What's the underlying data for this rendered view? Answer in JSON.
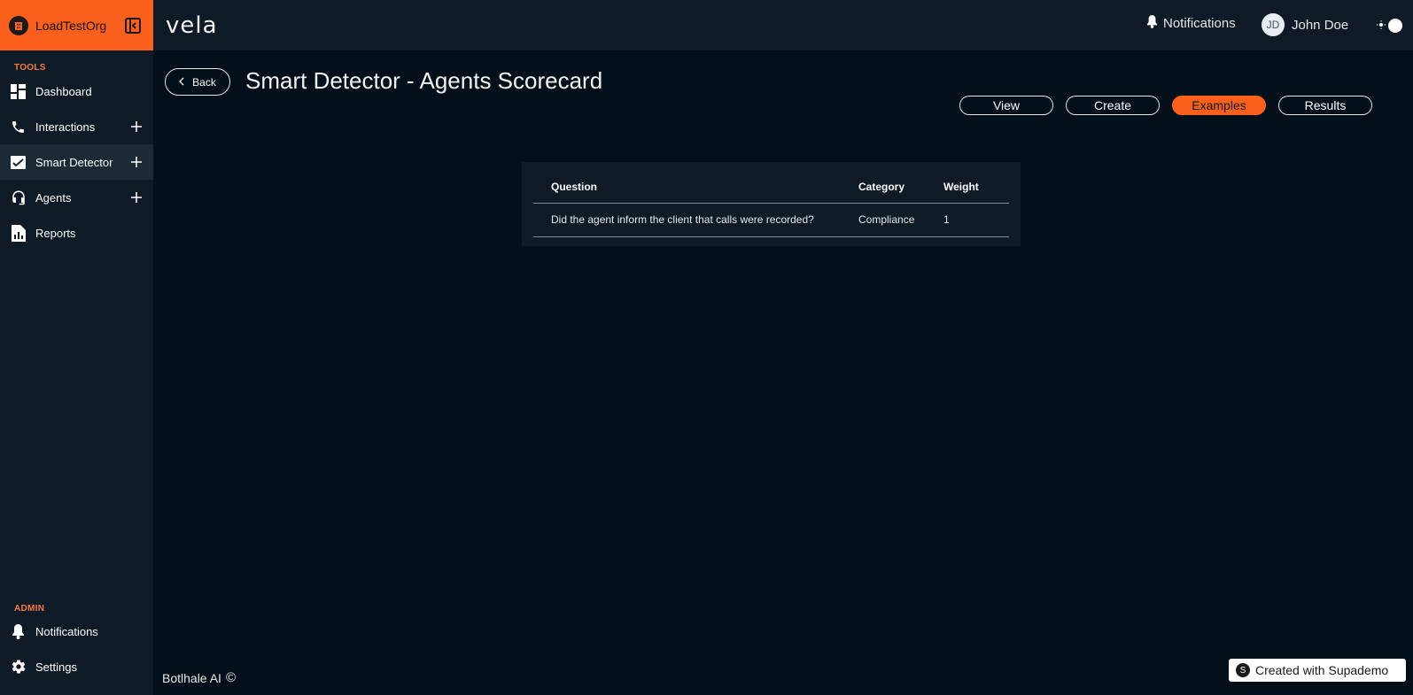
{
  "org": {
    "name": "LoadTestOrg"
  },
  "brand": {
    "name": "vela"
  },
  "sidebar": {
    "tools_label": "TOOLS",
    "admin_label": "ADMIN",
    "items": [
      {
        "label": "Dashboard",
        "icon": "dashboard-icon"
      },
      {
        "label": "Interactions",
        "icon": "phone-icon"
      },
      {
        "label": "Smart Detector",
        "icon": "chart-check-icon"
      },
      {
        "label": "Agents",
        "icon": "headset-icon"
      },
      {
        "label": "Reports",
        "icon": "report-icon"
      }
    ],
    "admin_items": [
      {
        "label": "Notifications",
        "icon": "bell-icon"
      },
      {
        "label": "Settings",
        "icon": "gear-icon"
      }
    ]
  },
  "header": {
    "notifications_label": "Notifications",
    "user_initials": "JD",
    "user_name": "John Doe"
  },
  "page": {
    "back_label": "Back",
    "title": "Smart Detector - Agents Scorecard",
    "tabs": [
      {
        "label": "View",
        "active": false
      },
      {
        "label": "Create",
        "active": false
      },
      {
        "label": "Examples",
        "active": true
      },
      {
        "label": "Results",
        "active": false
      }
    ]
  },
  "table": {
    "columns": [
      "Question",
      "Category",
      "Weight"
    ],
    "rows": [
      [
        "Did the agent inform the client that calls were recorded?",
        "Compliance",
        "1"
      ]
    ]
  },
  "footer": {
    "company": "Botlhale AI",
    "copyright_symbol": "©",
    "supademo_label": "Created with Supademo",
    "supademo_logo": "S"
  },
  "colors": {
    "accent": "#fa5f1c",
    "background": "#03101a",
    "panel": "#0e1a26"
  }
}
